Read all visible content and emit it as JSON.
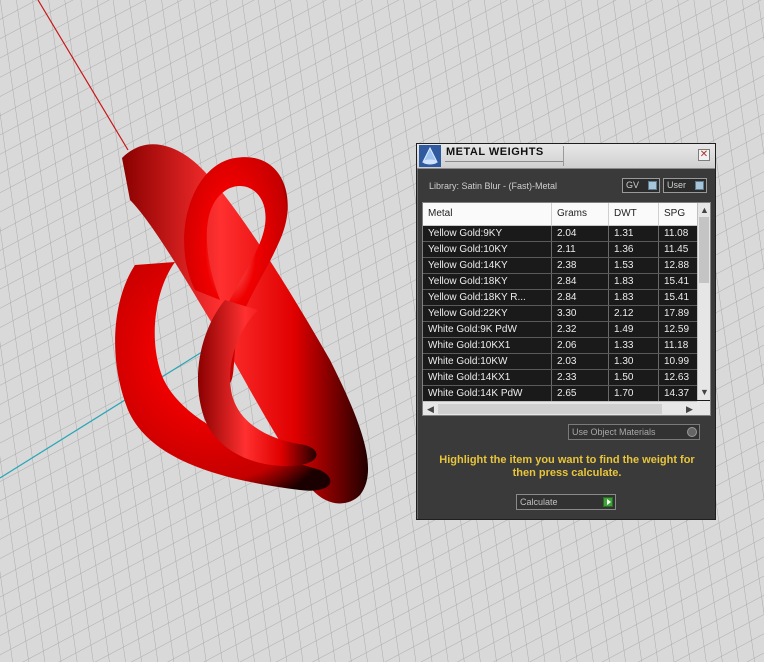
{
  "dialog": {
    "title": "METAL WEIGHTS",
    "close_glyph": "✕",
    "library_label": "Library: Satin Blur - (Fast)-Metal",
    "toggles": {
      "gv": "GV",
      "user": "User"
    },
    "table": {
      "columns": [
        "Metal",
        "Grams",
        "DWT",
        "SPG"
      ],
      "rows": [
        [
          "Yellow Gold:9KY",
          "2.04",
          "1.31",
          "11.08"
        ],
        [
          "Yellow Gold:10KY",
          "2.11",
          "1.36",
          "11.45"
        ],
        [
          "Yellow Gold:14KY",
          "2.38",
          "1.53",
          "12.88"
        ],
        [
          "Yellow Gold:18KY",
          "2.84",
          "1.83",
          "15.41"
        ],
        [
          "Yellow Gold:18KY R...",
          "2.84",
          "1.83",
          "15.41"
        ],
        [
          "Yellow Gold:22KY",
          "3.30",
          "2.12",
          "17.89"
        ],
        [
          "White Gold:9K PdW",
          "2.32",
          "1.49",
          "12.59"
        ],
        [
          "White Gold:10KX1",
          "2.06",
          "1.33",
          "11.18"
        ],
        [
          "White Gold:10KW",
          "2.03",
          "1.30",
          "10.99"
        ],
        [
          "White Gold:14KX1",
          "2.33",
          "1.50",
          "12.63"
        ],
        [
          "White Gold:14K PdW",
          "2.65",
          "1.70",
          "14.37"
        ]
      ]
    },
    "use_object_materials": "Use Object Materials",
    "hint": "Highlight the item you want to find the weight for then press calculate.",
    "calculate_label": "Calculate"
  },
  "colors": {
    "model_red": "#e30000",
    "axis_red": "#c81818",
    "axis_cyan": "#2aa6b8",
    "grid": "#a9a9a9",
    "hint_yellow": "#e8c53a"
  },
  "icons": {
    "title": "metal-weights-app-icon",
    "close": "close-icon",
    "scroll_up": "chevron-up-icon",
    "scroll_down": "chevron-down-icon",
    "scroll_left": "chevron-left-icon",
    "scroll_right": "chevron-right-icon",
    "calculate": "play-arrow-icon"
  }
}
